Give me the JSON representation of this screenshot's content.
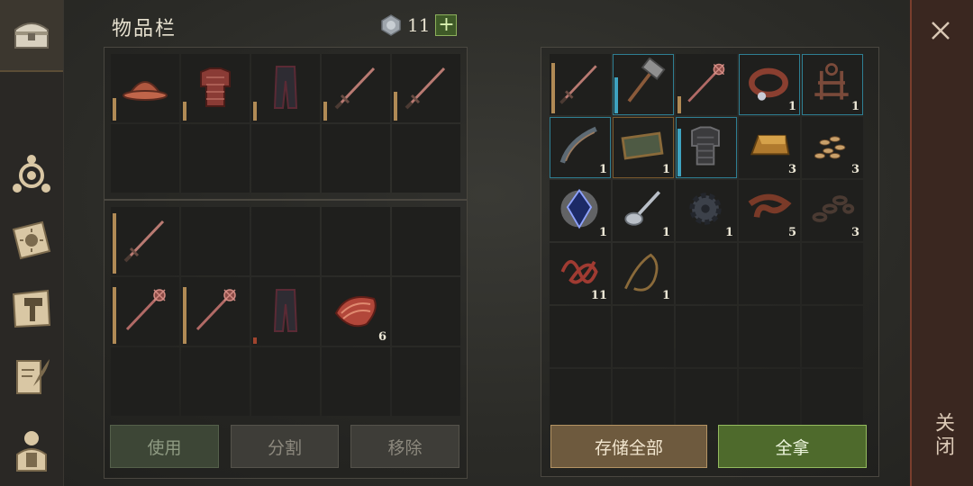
{
  "sidebar": {
    "items": [
      {
        "icon": "chest-icon",
        "active": true
      },
      {
        "icon": "skills-icon"
      },
      {
        "icon": "sun-book-icon"
      },
      {
        "icon": "crafting-hammer-icon"
      },
      {
        "icon": "scroll-quill-icon"
      },
      {
        "icon": "character-icon"
      }
    ]
  },
  "header": {
    "title": "物品栏",
    "currency_icon": "silver-coin-icon",
    "currency_count": "11",
    "add_label": "+"
  },
  "equipment": {
    "row1": [
      {
        "icon": "helmet-icon",
        "dur": 0.35
      },
      {
        "icon": "chainmail-icon",
        "dur": 0.3
      },
      {
        "icon": "leather-pants-icon",
        "dur": 0.3
      },
      {
        "icon": "sword-icon",
        "dur": 0.3
      },
      {
        "icon": "sword-icon",
        "dur": 0.45
      },
      {
        "icon": ""
      },
      {
        "icon": ""
      },
      {
        "icon": ""
      },
      {
        "icon": ""
      },
      {
        "icon": ""
      }
    ]
  },
  "inventory": {
    "slots": [
      {
        "icon": "sword-icon",
        "dur": 0.95
      },
      {
        "icon": ""
      },
      {
        "icon": ""
      },
      {
        "icon": ""
      },
      {
        "icon": ""
      },
      {
        "icon": "mace-spear-icon",
        "dur": 0.9
      },
      {
        "icon": "mace-spear-icon",
        "dur": 0.9
      },
      {
        "icon": "leather-pants-icon",
        "dur": 0.1
      },
      {
        "icon": "bacon-icon",
        "qty": "6"
      },
      {
        "icon": ""
      },
      {
        "icon": ""
      },
      {
        "icon": ""
      },
      {
        "icon": ""
      },
      {
        "icon": ""
      },
      {
        "icon": ""
      }
    ]
  },
  "storage": {
    "slots": [
      {
        "icon": "sword-icon",
        "dur": 0.9
      },
      {
        "icon": "sledgehammer-icon",
        "dur": 0.65,
        "bar_color": "#3ea3c0",
        "rarity": "rare"
      },
      {
        "icon": "mace-spear-icon",
        "dur": 0.3
      },
      {
        "icon": "collar-icon",
        "qty": "1",
        "rarity": "rare"
      },
      {
        "icon": "saddle-frame-icon",
        "qty": "1",
        "rarity": "rare"
      },
      {
        "icon": "bow-icon",
        "qty": "1",
        "rarity": "rare"
      },
      {
        "icon": "slate-board-icon",
        "qty": "1",
        "rarity": "uncommon"
      },
      {
        "icon": "scale-armor-icon",
        "dur": 0.85,
        "bar_color": "#3ea3c0",
        "rarity": "rare"
      },
      {
        "icon": "gold-ingot-icon",
        "qty": "3"
      },
      {
        "icon": "seeds-icon",
        "qty": "3"
      },
      {
        "icon": "crystal-icon",
        "qty": "1"
      },
      {
        "icon": "spoon-icon",
        "qty": "1"
      },
      {
        "icon": "gear-icon",
        "qty": "1"
      },
      {
        "icon": "leather-strap-icon",
        "qty": "5"
      },
      {
        "icon": "chain-icon",
        "qty": "3"
      },
      {
        "icon": "tangled-rope-icon",
        "qty": "11"
      },
      {
        "icon": "rope-icon",
        "qty": "1"
      },
      {
        "icon": ""
      },
      {
        "icon": ""
      },
      {
        "icon": ""
      },
      {
        "icon": ""
      },
      {
        "icon": ""
      },
      {
        "icon": ""
      },
      {
        "icon": ""
      },
      {
        "icon": ""
      },
      {
        "icon": ""
      },
      {
        "icon": ""
      },
      {
        "icon": ""
      },
      {
        "icon": ""
      },
      {
        "icon": ""
      }
    ]
  },
  "actions": {
    "use": "使用",
    "split": "分割",
    "remove": "移除",
    "store_all": "存储全部",
    "take_all": "全拿"
  },
  "close": {
    "label": "关闭",
    "icon": "close-icon"
  },
  "colors": {
    "durability": "#b08a55",
    "rare_bar": "#3ea3c0",
    "take_green": "#4e6a2c",
    "store_brown": "#6e5a3e"
  }
}
